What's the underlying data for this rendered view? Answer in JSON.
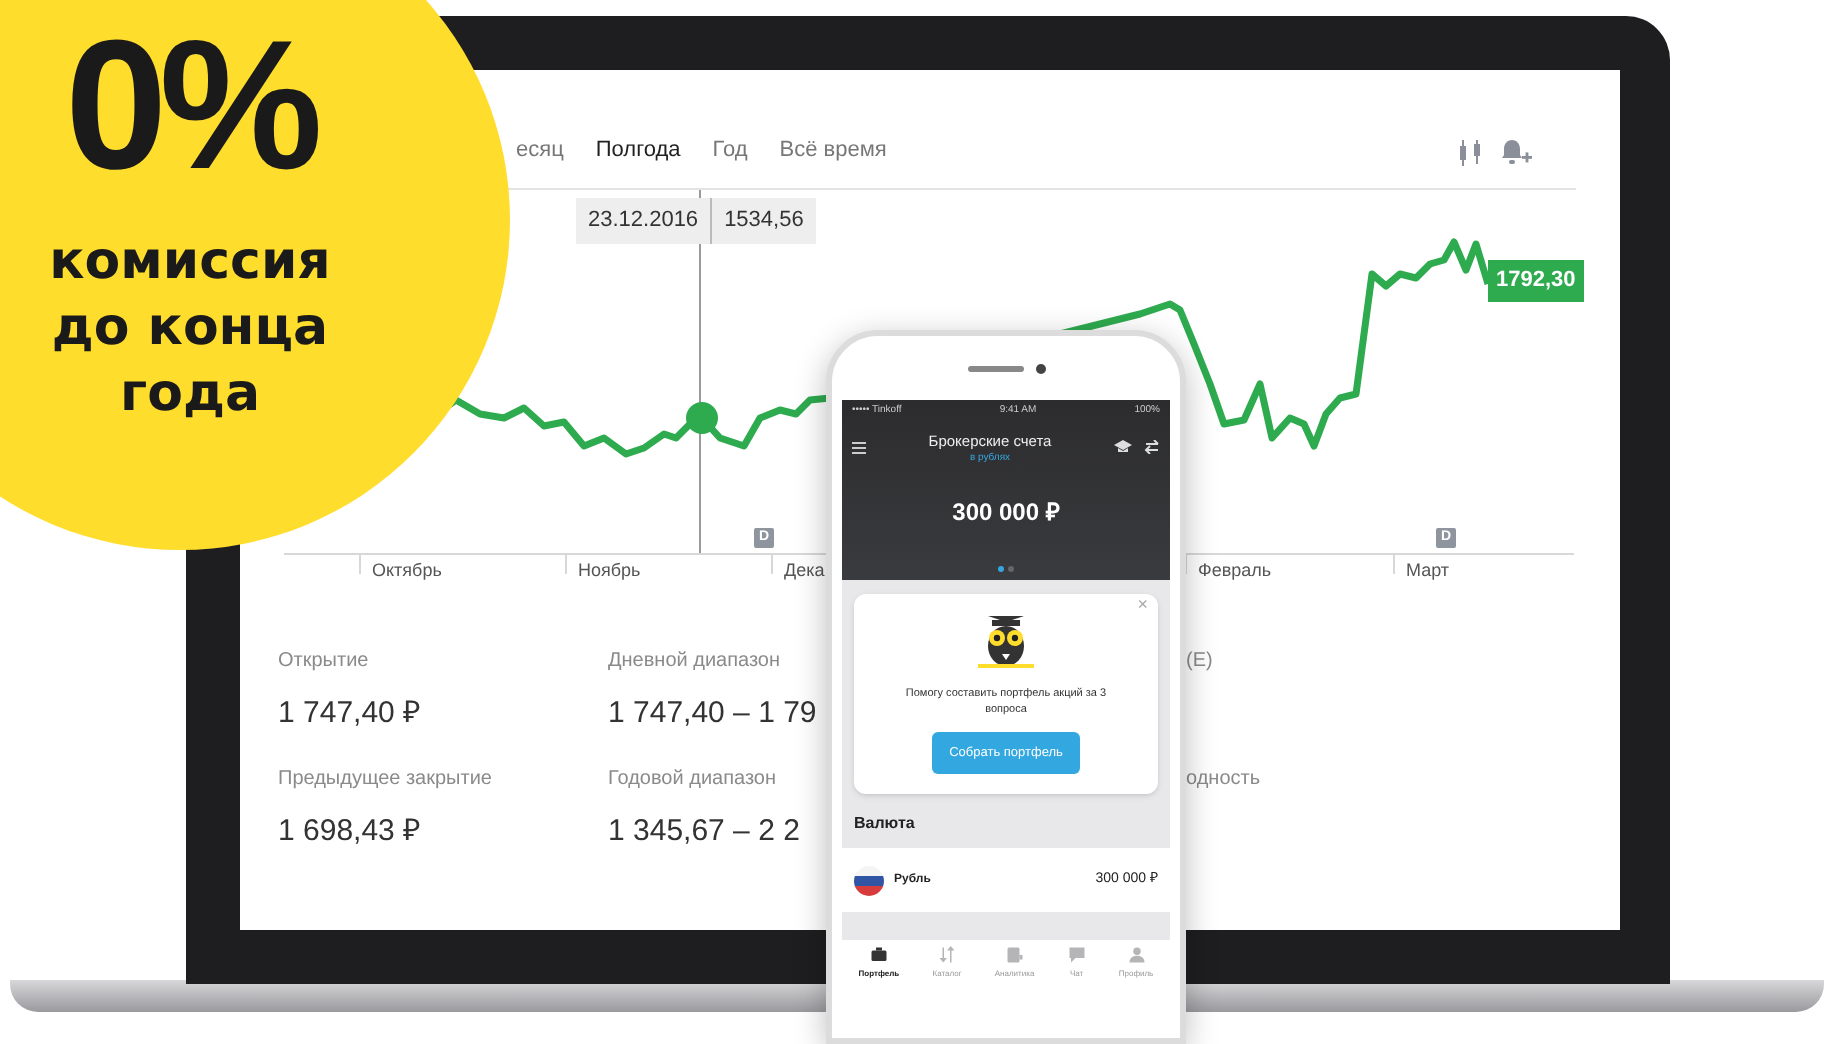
{
  "promo": {
    "headline": "0%",
    "lines": [
      "комиссия",
      "до конца",
      "года"
    ]
  },
  "laptop": {
    "periods": [
      {
        "label": "есяц",
        "selected": false
      },
      {
        "label": "Полгода",
        "selected": true
      },
      {
        "label": "Год",
        "selected": false
      },
      {
        "label": "Всё время",
        "selected": false
      }
    ],
    "tooltip": {
      "date": "23.12.2016",
      "value": "1534,56"
    },
    "last_value": "1792,30",
    "markers": [
      "D",
      "D"
    ],
    "months": [
      "Октябрь",
      "Ноябрь",
      "Дека",
      "Февраль",
      "Март"
    ],
    "stats": [
      {
        "label": "Открытие",
        "value": "1 747,40 ₽"
      },
      {
        "label": "Дневной диапазон",
        "value": "1 747,40 – 1 79"
      },
      {
        "label": "(E)"
      },
      {
        "label": "Предыдущее закрытие",
        "value": "1 698,43 ₽"
      },
      {
        "label": "Годовой диапазон",
        "value": "1 345,67 – 2 2"
      },
      {
        "label": "одность"
      }
    ]
  },
  "phone": {
    "status": {
      "carrier": "••••• Tinkoff",
      "time": "9:41 AM",
      "battery": "100%"
    },
    "title": "Брокерские счета",
    "subtitle": "в рублях",
    "balance": "300 000 ₽",
    "pager": [
      {
        "selected": true
      },
      {
        "selected": false
      }
    ],
    "card": {
      "close": "×",
      "text": "Помогу составить портфель акций за 3 вопроса",
      "button": "Собрать портфель"
    },
    "section": "Валюта",
    "rows": [
      {
        "name": "Рубль",
        "amount": "300 000 ₽"
      }
    ],
    "tabs": [
      {
        "label": "Портфель",
        "selected": true
      },
      {
        "label": "Каталог",
        "selected": false
      },
      {
        "label": "Аналитика",
        "selected": false
      },
      {
        "label": "Чат",
        "selected": false
      },
      {
        "label": "Профиль",
        "selected": false
      }
    ]
  }
}
